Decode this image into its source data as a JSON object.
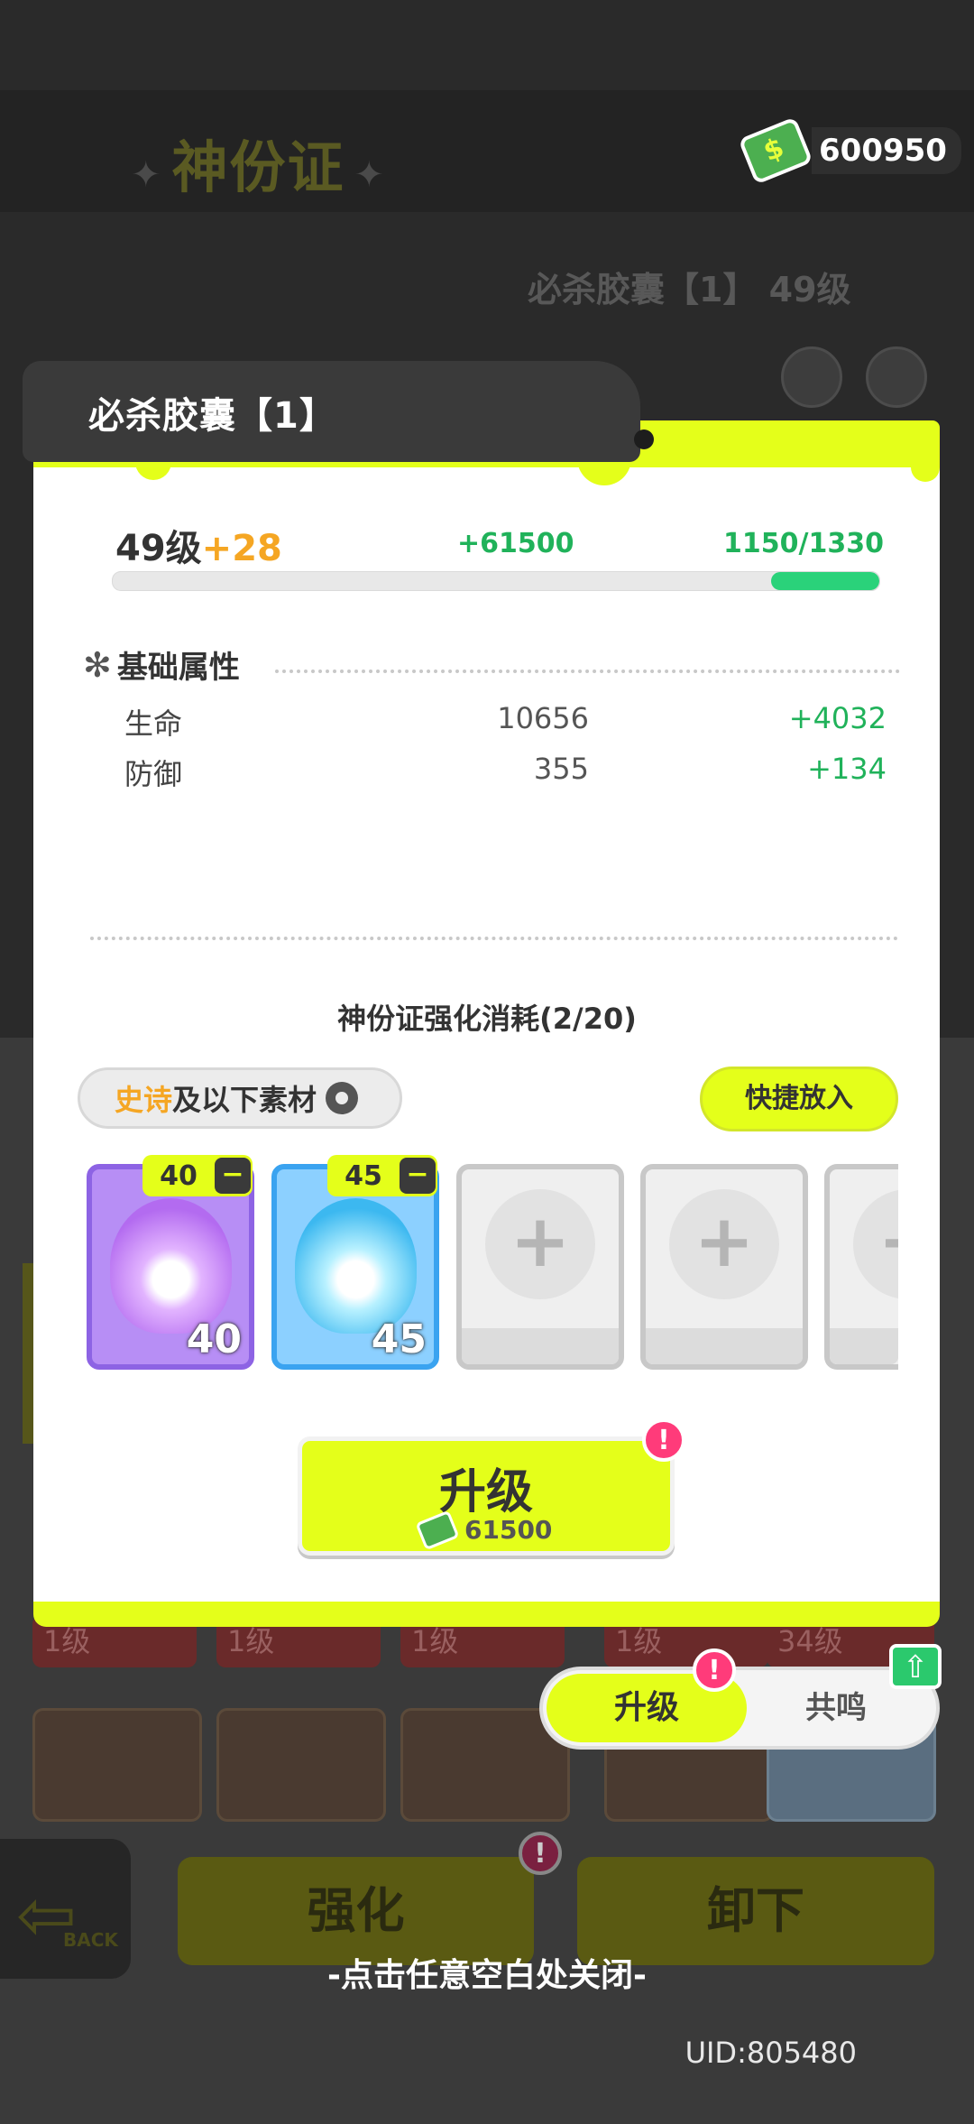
{
  "currency": {
    "amount": "600950",
    "icon": "cash-icon"
  },
  "background": {
    "title": "神份证",
    "skill_label": "必杀胶囊【1】 49级",
    "level_chips": [
      "1级",
      "1级",
      "1级",
      "1级",
      "34级"
    ],
    "back_label": "BACK",
    "strengthen_label": "强化",
    "unequip_label": "卸下"
  },
  "dialog": {
    "title": "必杀胶囊【1】",
    "level": "49级",
    "level_gain": "+28",
    "currency_gain": "+61500",
    "exp": "1150/1330",
    "exp_progress": 0.86,
    "section_title": "基础属性",
    "attributes": [
      {
        "name": "生命",
        "value": "10656",
        "increase": "+4032"
      },
      {
        "name": "防御",
        "value": "355",
        "increase": "+134"
      }
    ],
    "cost_title": "神份证强化消耗(2/20)",
    "filter": {
      "epic": "史诗",
      "rest": "及以下素材"
    },
    "quick_fill": "快捷放入",
    "materials": [
      {
        "type": "purple-flame",
        "selected": "40",
        "count": "40"
      },
      {
        "type": "blue-flame",
        "selected": "45",
        "count": "45"
      }
    ],
    "add_symbol": "+",
    "minus_symbol": "−",
    "upgrade_label": "升级",
    "upgrade_cost": "61500",
    "alert": "!"
  },
  "tabs": {
    "upgrade": "升级",
    "resonance": "共鸣"
  },
  "close_hint": "-点击任意空白处关闭-",
  "uid": "UID:805480",
  "colors": {
    "accent": "#e4ff1a",
    "positive": "#20b25a",
    "highlight": "#f5a623",
    "alert": "#ff3b7a"
  }
}
